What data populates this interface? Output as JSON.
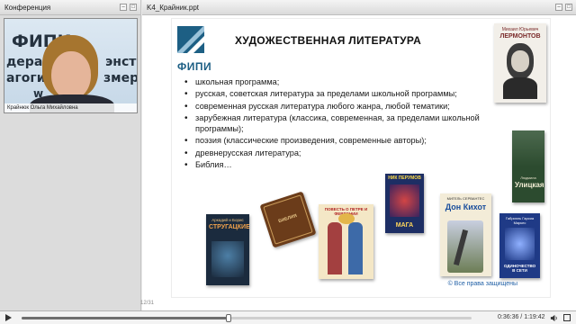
{
  "left_window": {
    "title": "Конференция",
    "video": {
      "banner_line1": "ФИПИ",
      "banner_line2": "дерально",
      "banner_line3": "энст",
      "banner_line4": "агогич",
      "banner_line5": "змере",
      "banner_line6": "w",
      "caption": "Крайнюк Ольга Михайловна"
    }
  },
  "right_window": {
    "title": "K4_Крайник.ppt"
  },
  "slide": {
    "logo_text": "ФИПИ",
    "title": "ХУДОЖЕСТВЕННАЯ  ЛИТЕРАТУРА",
    "bullets": [
      "школьная программа;",
      "русская, советская  литература за пределами школьной программы;",
      "современная русская литература любого жанра, любой тематики;",
      "зарубежная литература (классика, современная, за пределами школьной программы);",
      "поэзия (классические произведения, современные авторы);",
      "древнерусская литература;",
      "Библия…"
    ],
    "books": {
      "lermontov_author": "Михаил Юрьевич",
      "lermontov_name": "ЛЕРМОНТОВ",
      "ulitskaya_author": "Людмила",
      "ulitskaya_name": "Улицкая",
      "strugatsky_author": "Аркадий и Борис",
      "strugatsky_name": "СТРУГАЦКИЕ",
      "bible_name": "БИБЛИЯ",
      "povest_name": "ПОВЕСТЬ О ПЕТРЕ И ФЕВРОНИИ",
      "perumov_author": "НИК ПЕРУМОВ",
      "perumov_name": "МАГА",
      "cervantes_author": "МИГЕЛЬ СЕРВАНТЕС",
      "donquixote_name": "Дон Кихот",
      "marquez_author": "Габриэль Гарсиа Маркес",
      "marquez_name": "ОДИНОЧЕСТВО В СЕТИ"
    },
    "copyright": "© Все права защищены",
    "counter": "12/31"
  },
  "player": {
    "time": "0:36:36 / 1:19:42",
    "progress_fraction": 0.46
  },
  "colors": {
    "fipi_blue": "#1d5f84",
    "link_blue": "#1f5fa5"
  }
}
